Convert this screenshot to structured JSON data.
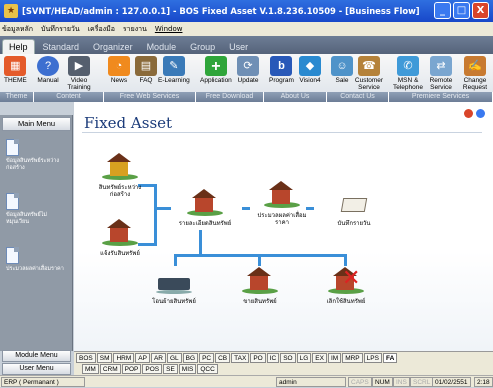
{
  "window": {
    "title": "[SVNT/HEAD/admin : 127.0.0.1] - BOS Fixed Asset V.1.8.236.10509 - [Business Flow]",
    "controls": [
      "_",
      "□",
      "X"
    ]
  },
  "menu": [
    "ข้อมูลหลัก",
    "บันทึกรายวัน",
    "เครื่องมือ",
    "รายงาน",
    "Window"
  ],
  "tabs": [
    {
      "label": "Help",
      "active": true
    },
    {
      "label": "Standard"
    },
    {
      "label": "Organizer"
    },
    {
      "label": "Module"
    },
    {
      "label": "Group"
    },
    {
      "label": "User"
    }
  ],
  "ribbon": {
    "buttons": [
      {
        "label": "THEME",
        "icon": "theme-icon",
        "color": "#e45a2a"
      },
      {
        "label": "Manual",
        "icon": "manual-icon",
        "color": "#3d6fd0"
      },
      {
        "label": "Video Training",
        "icon": "video-icon",
        "color": "#555f6e"
      },
      {
        "label": "News",
        "icon": "rss-icon",
        "color": "#f08a1e"
      },
      {
        "label": "FAQ",
        "icon": "faq-icon",
        "color": "#8a6a3a"
      },
      {
        "label": "E-Learning",
        "icon": "elearning-icon",
        "color": "#3a7ab8"
      },
      {
        "label": "Application",
        "icon": "application-icon",
        "color": "#2fa53a"
      },
      {
        "label": "Update",
        "icon": "update-icon",
        "color": "#6f8fb5"
      },
      {
        "label": "Program",
        "icon": "program-icon",
        "color": "#2858b8"
      },
      {
        "label": "Vision4",
        "icon": "vision4-icon",
        "color": "#2a8ad0"
      },
      {
        "label": "Sale",
        "icon": "sale-icon",
        "color": "#4f93c9"
      },
      {
        "label": "Customer Service",
        "icon": "customer-service-icon",
        "color": "#b5823a"
      },
      {
        "label": "MSN & Telephone",
        "icon": "msn-icon",
        "color": "#3f9ad8"
      },
      {
        "label": "Remote Service",
        "icon": "remote-icon",
        "color": "#7aa6d0"
      },
      {
        "label": "Change Request",
        "icon": "change-request-icon",
        "color": "#c87a30"
      }
    ],
    "groups": [
      "Theme",
      "Content",
      "Free Web Services",
      "Free Download",
      "About Us",
      "Contact Us",
      "Premiere Services"
    ]
  },
  "sidebar": {
    "header": "Main Menu",
    "items": [
      {
        "label": "ข้อมูลสินทรัพย์ระหว่างก่อสร้าง"
      },
      {
        "label": "ข้อมูลสินทรัพย์ไม่หมุนเวียน"
      },
      {
        "label": "ประมวลผลค่าเสื่อมราคา"
      }
    ],
    "module_menu": "Module Menu",
    "user_menu": "User Menu"
  },
  "main": {
    "title": "Fixed Asset",
    "nodes": [
      {
        "label": "สินทรัพย์ระหว่างก่อสร้าง"
      },
      {
        "label": "แจ้งรับสินทรัพย์"
      },
      {
        "label": "รายละเอียดสินทรัพย์"
      },
      {
        "label": "ประมวลผลค่าเสื่อมราคา"
      },
      {
        "label": "บันทึกรายวัน"
      },
      {
        "label": "โอนย้ายสินทรัพย์"
      },
      {
        "label": "ขายสินทรัพย์"
      },
      {
        "label": "เลิกใช้สินทรัพย์"
      }
    ]
  },
  "module_tabs": [
    "BOS",
    "SM",
    "HRM",
    "AP",
    "AR",
    "GL",
    "BG",
    "PC",
    "CB",
    "TAX",
    "PO",
    "IC",
    "SO",
    "LG",
    "EX",
    "IM",
    "MRP",
    "LPS",
    "FA"
  ],
  "module_tabs_active": "FA",
  "user_tabs": [
    "MM",
    "CRM",
    "POP",
    "POS",
    "SE",
    "MIS",
    "QCC"
  ],
  "status": {
    "company": "ERP ( Permanant )",
    "user": "admin",
    "caps": "CAPS",
    "num": "NUM",
    "ins": "INS",
    "scrl": "SCRL",
    "date": "01/02/2551",
    "time": "2:18"
  }
}
